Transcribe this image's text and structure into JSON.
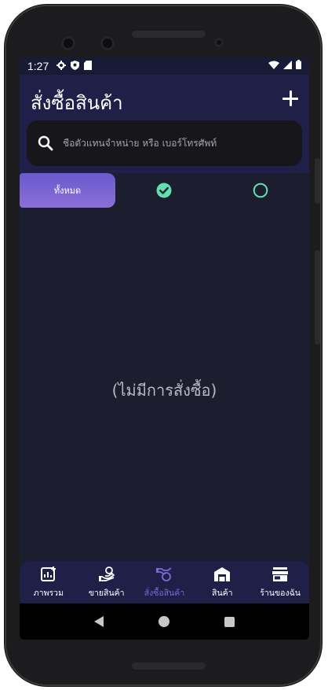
{
  "status": {
    "time": "1:27",
    "left_icons": [
      "settings-icon",
      "shield-icon",
      "sdcard-icon"
    ],
    "right_icons": [
      "wifi-icon",
      "signal-icon",
      "battery-icon"
    ]
  },
  "header": {
    "title": "สั่งซื้อสินค้า",
    "add_icon": "plus-icon"
  },
  "search": {
    "placeholder": "ชื่อตัวแทนจำหน่าย หรือ เบอร์โทรศัพท์"
  },
  "filters": {
    "all_label": "ทั้งหมด",
    "done_icon": "check-circle-icon",
    "pending_icon": "empty-circle-icon",
    "accent": "#5fe0b0"
  },
  "empty_message": "(ไม่มีการสั่งซื้อ)",
  "bottom_nav": {
    "items": [
      {
        "label": "ภาพรวม",
        "icon": "dashboard-icon"
      },
      {
        "label": "ขายสินค้า",
        "icon": "sell-icon"
      },
      {
        "label": "สั่งซื้อสินค้า",
        "icon": "order-icon",
        "active": true
      },
      {
        "label": "สินค้า",
        "icon": "warehouse-icon"
      },
      {
        "label": "ร้านของฉัน",
        "icon": "store-icon"
      }
    ],
    "active_color": "#7c6ad6"
  }
}
